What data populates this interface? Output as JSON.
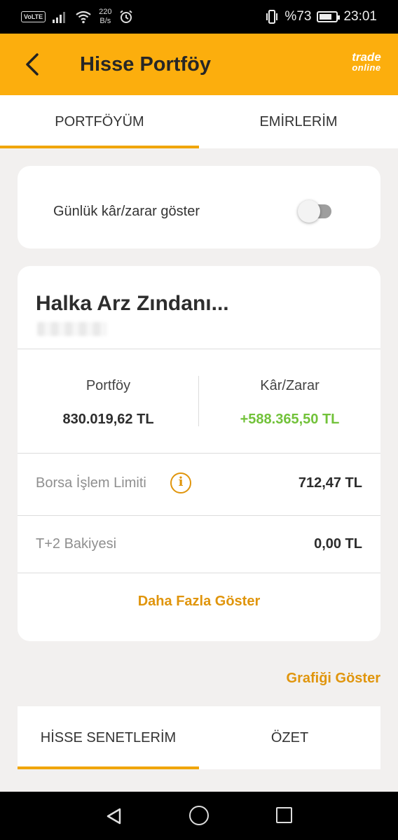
{
  "status_bar": {
    "volte": "VoLTE",
    "speed_value": "220",
    "speed_unit": "B/s",
    "battery": "%73",
    "battery_level": 0.73,
    "time": "23:01"
  },
  "header": {
    "title": "Hisse Portföy",
    "logo_line1": "trade",
    "logo_line2": "online"
  },
  "tabs": {
    "portfolio": "PORTFÖYÜM",
    "orders": "EMİRLERİM"
  },
  "toggle": {
    "label": "Günlük kâr/zarar göster",
    "on": false
  },
  "portfolio": {
    "name": "Halka Arz Zındanı...",
    "portfolio_label": "Portföy",
    "portfolio_value": "830.019,62 TL",
    "pl_label": "Kâr/Zarar",
    "pl_value": "+588.365,50 TL",
    "limit_label": "Borsa İşlem Limiti",
    "limit_value": "712,47 TL",
    "t2_label": "T+2 Bakiyesi",
    "t2_value": "0,00 TL",
    "more": "Daha Fazla Göster"
  },
  "chart_link": "Grafiği Göster",
  "bottom_tabs": {
    "stocks": "HİSSE SENETLERİM",
    "summary": "ÖZET"
  },
  "colors": {
    "accent": "#fcae0d",
    "link": "#e0950c",
    "positive": "#72c23a"
  }
}
